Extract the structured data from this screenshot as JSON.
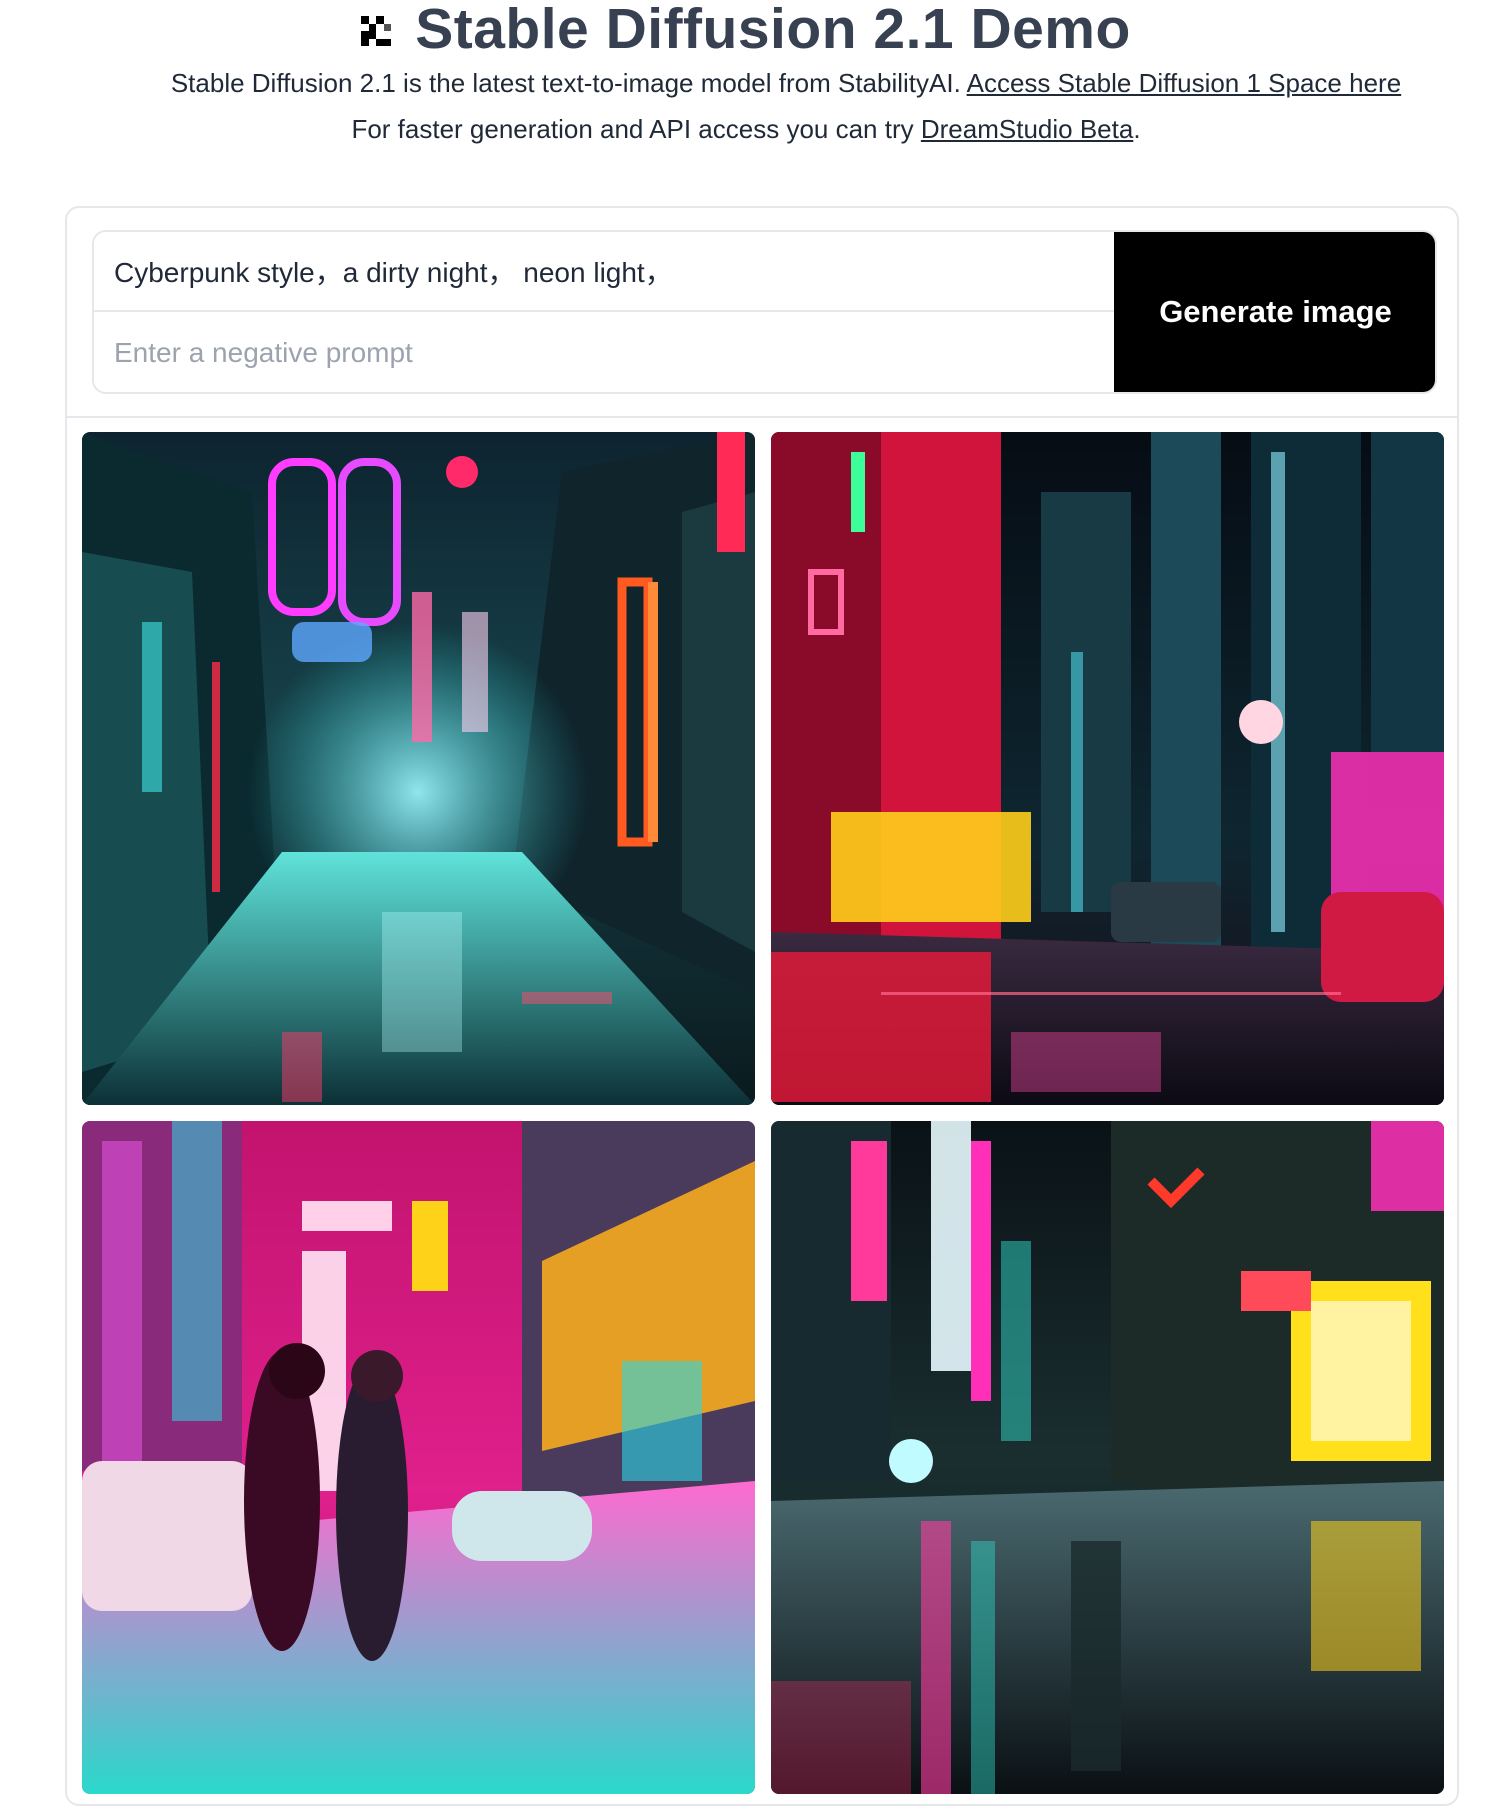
{
  "header": {
    "title": "Stable Diffusion 2.1 Demo",
    "description_text": "Stable Diffusion 2.1 is the latest text-to-image model from StabilityAI. ",
    "description_link": "Access Stable Diffusion 1 Space here",
    "faster_text": "For faster generation and API access you can try ",
    "faster_link": "DreamStudio Beta",
    "faster_end": "."
  },
  "prompt": {
    "value": "Cyberpunk style，a dirty night， neon light，",
    "negative_placeholder": "Enter a negative prompt",
    "negative_value": ""
  },
  "generate_button": {
    "label": "Generate image"
  },
  "gallery": {
    "images": [
      {
        "icon": "generated-image",
        "description_colors": [
          "#0c1c24",
          "#37d6d0",
          "#e040ff",
          "#ff5a1f"
        ]
      },
      {
        "icon": "generated-image",
        "description_colors": [
          "#0b1420",
          "#ff1f4f",
          "#26c9c9",
          "#ff2fb8"
        ]
      },
      {
        "icon": "generated-image",
        "description_colors": [
          "#c01070",
          "#2ce0d8",
          "#ffd21a",
          "#e21aa0"
        ]
      },
      {
        "icon": "generated-image",
        "description_colors": [
          "#0a1418",
          "#ff2a7a",
          "#2fd8c8",
          "#ffe01a"
        ]
      }
    ]
  }
}
